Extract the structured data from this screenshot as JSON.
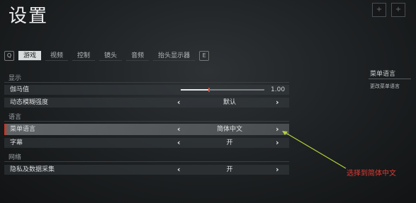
{
  "window": {
    "title": "设置"
  },
  "corner": {
    "btn1": "+",
    "btn2": "+"
  },
  "tabs": {
    "prev_key": "Q",
    "next_key": "E",
    "items": [
      {
        "label": "游戏",
        "active": true
      },
      {
        "label": "视频",
        "active": false
      },
      {
        "label": "控制",
        "active": false
      },
      {
        "label": "镜头",
        "active": false
      },
      {
        "label": "音频",
        "active": false
      },
      {
        "label": "抬头显示器",
        "active": false
      }
    ]
  },
  "sections": {
    "display": "显示",
    "language": "语言",
    "network": "网络"
  },
  "settings": {
    "gamma": {
      "label": "伽马值",
      "value": "1.00",
      "level": 0.33
    },
    "motion_blur": {
      "label": "动态模糊强度",
      "value": "默认"
    },
    "menu_language": {
      "label": "菜单语言",
      "value": "简体中文"
    },
    "subtitles": {
      "label": "字幕",
      "value": "开"
    },
    "privacy": {
      "label": "隐私及数据采集",
      "value": "开"
    }
  },
  "arrows": {
    "left": "‹",
    "right": "›"
  },
  "side_panel": {
    "title": "菜单语言",
    "description": "更改菜单语言"
  },
  "annotation": {
    "text": "选择到简体中文",
    "color": "#e23a33"
  },
  "colors": {
    "accent_red": "#c03a2b",
    "active_tab": "#d9dcdd"
  }
}
